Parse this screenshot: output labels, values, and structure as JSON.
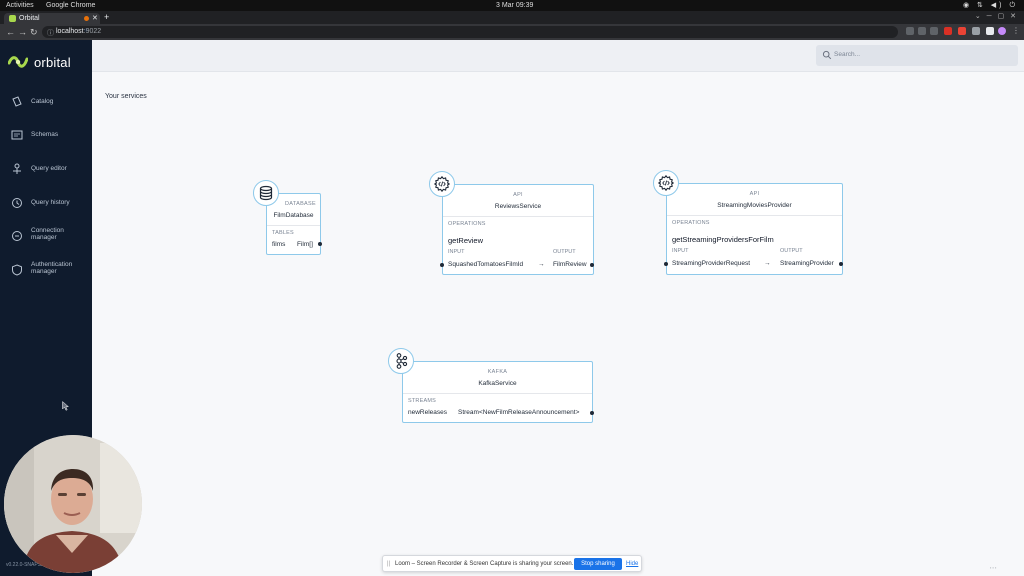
{
  "os": {
    "activities": "Activities",
    "app": "Google Chrome",
    "clock": "3 Mar  09:39"
  },
  "browser": {
    "tab_title": "Orbital",
    "url_host": "localhost",
    "url_port": ":9022"
  },
  "app": {
    "logo_text": "orbital",
    "version": "v0.22.0-SNAPSH...",
    "search_placeholder": "Search...",
    "section_title": "Your services",
    "nav": {
      "catalog": "Catalog",
      "schemas": "Schemas",
      "query_editor": "Query editor",
      "query_history": "Query history",
      "connection_1": "Connection",
      "connection_2": "manager",
      "auth_1": "Authentication",
      "auth_2": "manager"
    }
  },
  "services": {
    "film_database": {
      "kind": "DATABASE",
      "name": "FilmDatabase",
      "section": "TABLES",
      "row_name": "films",
      "row_type": "Film[]"
    },
    "reviews_service": {
      "kind": "API",
      "name": "ReviewsService",
      "section": "OPERATIONS",
      "operation": "getReview",
      "input_label": "INPUT",
      "output_label": "OUTPUT",
      "input": "SquashedTomatoesFilmId",
      "arrow": "→",
      "output": "FilmReview"
    },
    "streaming_movies_provider": {
      "kind": "API",
      "name": "StreamingMoviesProvider",
      "section": "OPERATIONS",
      "operation": "getStreamingProvidersForFilm",
      "input_label": "INPUT",
      "output_label": "OUTPUT",
      "input": "StreamingProviderRequest",
      "arrow": "→",
      "output": "StreamingProvider"
    },
    "kafka_service": {
      "kind": "KAFKA",
      "name": "KafkaService",
      "section": "STREAMS",
      "row_name": "newReleases",
      "row_type": "Stream<NewFilmReleaseAnnouncement>"
    }
  },
  "share_bar": {
    "grip": "||",
    "text": "Loom – Screen Recorder & Screen Capture is sharing your screen.",
    "stop": "Stop sharing",
    "hide": "Hide"
  },
  "colors": {
    "sidebar": "#0f1b2d",
    "card_border": "#8ec9ea",
    "accent": "#1a73e8",
    "logo": "#a8d84d"
  }
}
